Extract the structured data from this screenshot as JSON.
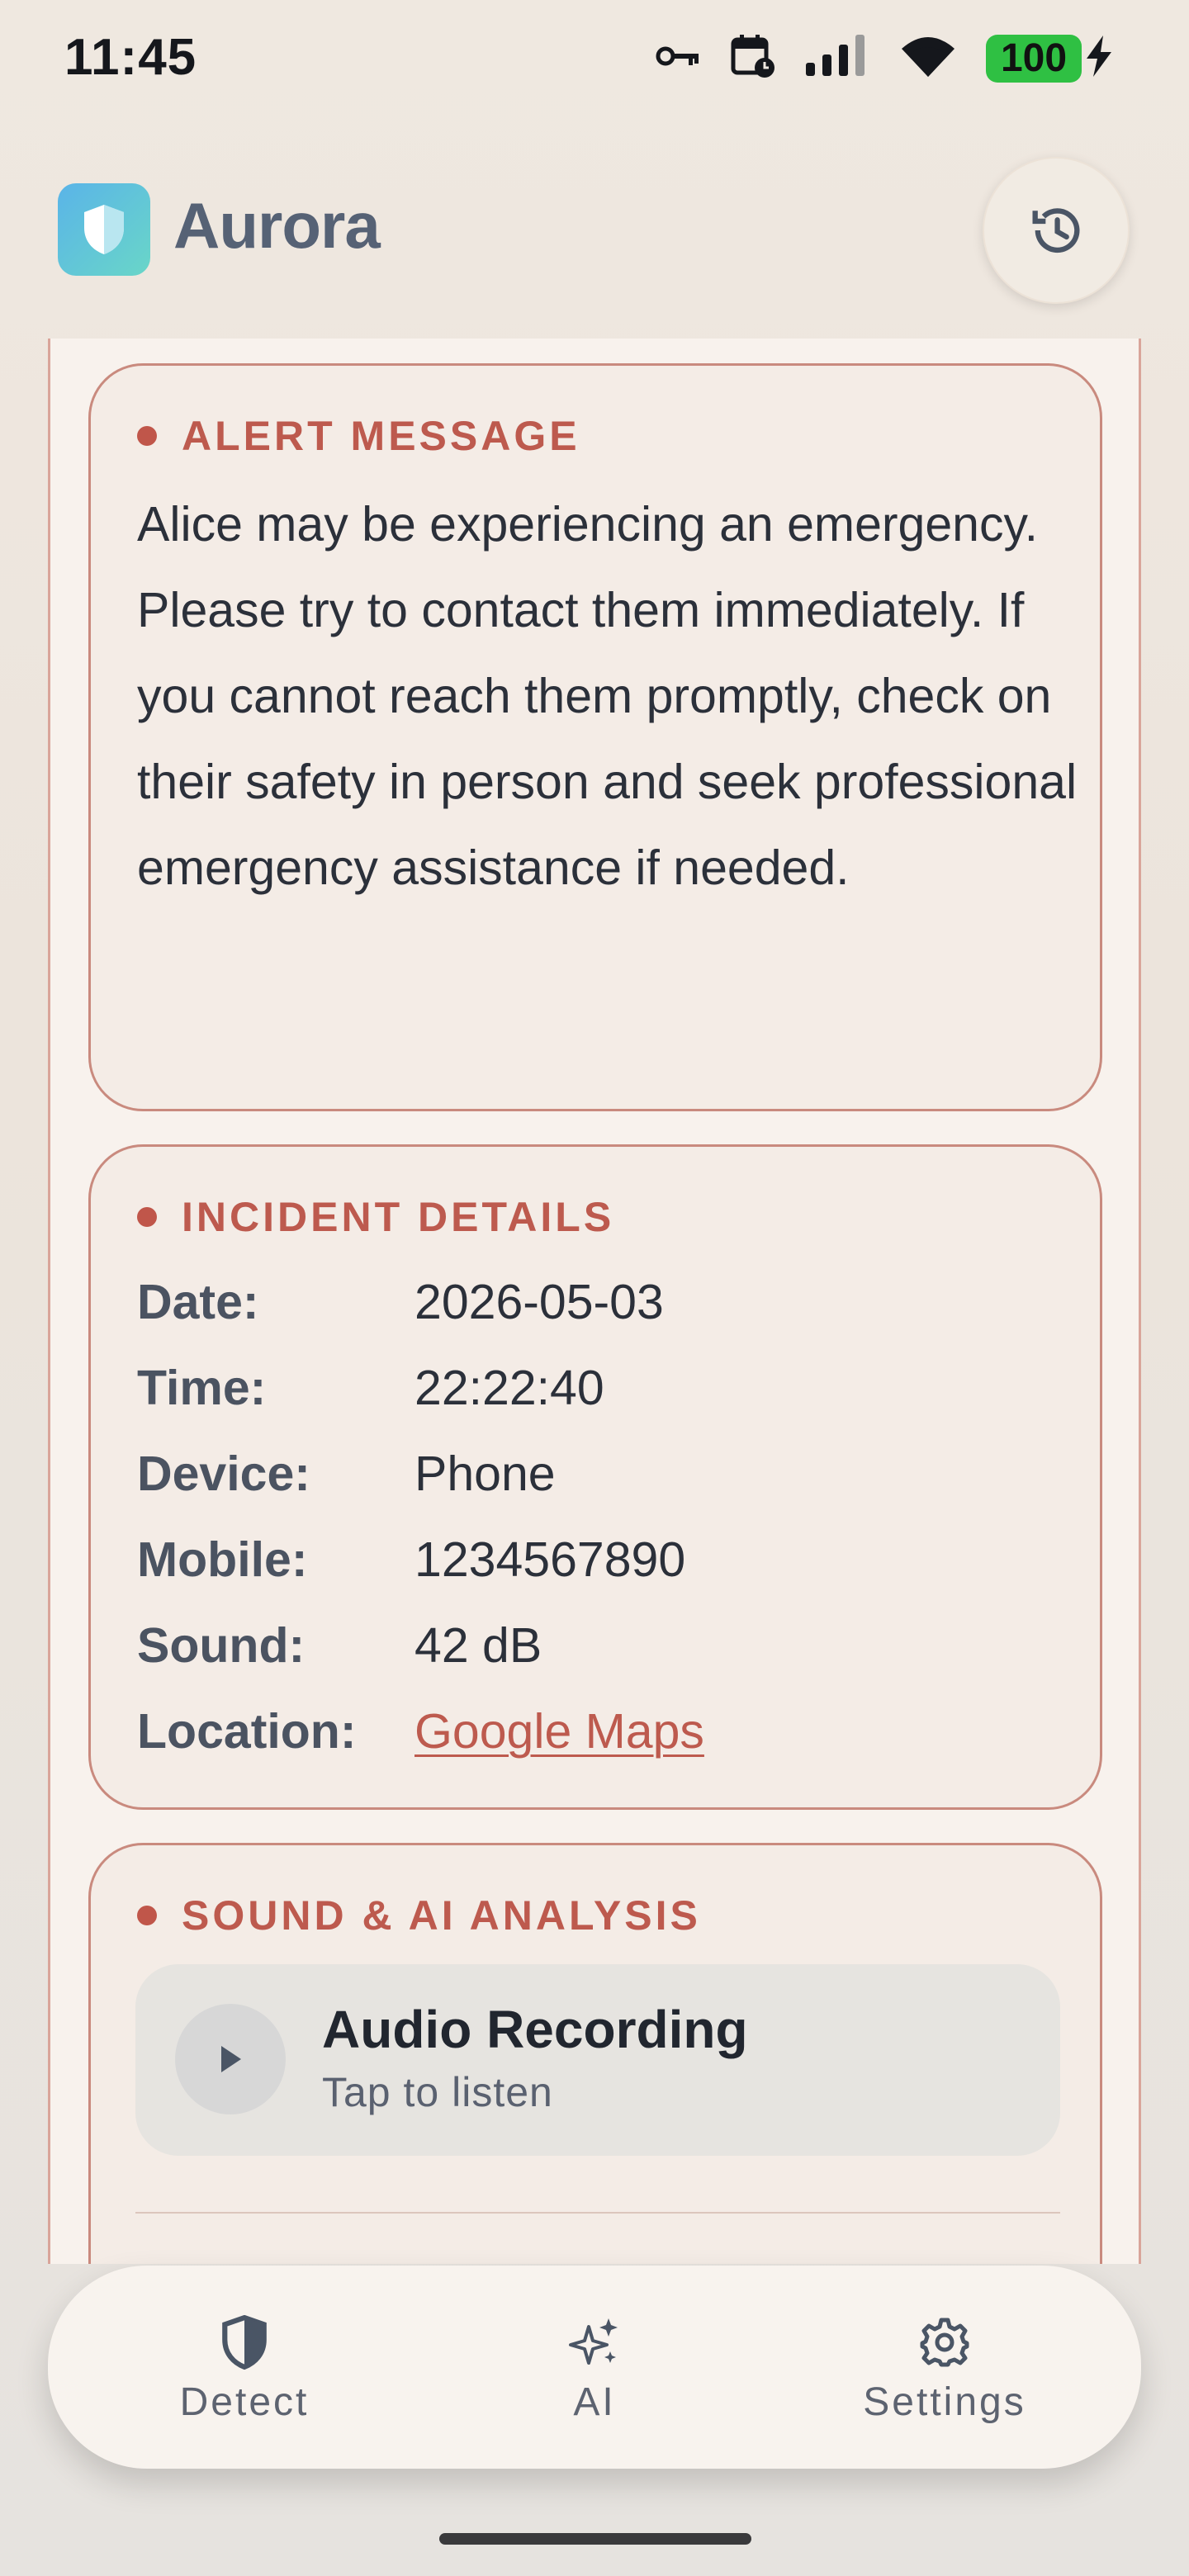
{
  "status_bar": {
    "time": "11:45",
    "battery": "100"
  },
  "header": {
    "app_name": "Aurora"
  },
  "alert_card": {
    "heading": "ALERT MESSAGE",
    "message": "Alice may be experiencing an emergency. Please try to contact them immediately. If you cannot reach them promptly, check on their safety in person and seek professional emergency assistance if needed."
  },
  "incident_card": {
    "heading": "INCIDENT DETAILS",
    "rows": [
      {
        "label": "Date:",
        "value": "2026-05-03"
      },
      {
        "label": "Time:",
        "value": "22:22:40"
      },
      {
        "label": "Device:",
        "value": "Phone"
      },
      {
        "label": "Mobile:",
        "value": "1234567890"
      },
      {
        "label": "Sound:",
        "value": "42 dB"
      },
      {
        "label": "Location:",
        "value": "Google Maps"
      }
    ]
  },
  "sound_card": {
    "heading": "SOUND & AI ANALYSIS",
    "audio_title": "Audio Recording",
    "audio_subtitle": "Tap to listen"
  },
  "bottom_nav": {
    "items": [
      {
        "label": "Detect",
        "icon": "shield-icon"
      },
      {
        "label": "AI",
        "icon": "sparkles-icon"
      },
      {
        "label": "Settings",
        "icon": "gear-icon"
      }
    ]
  },
  "colors": {
    "accent": "#bd5a4e",
    "card_border": "#c98a7e",
    "battery": "#2fc043",
    "logo_start": "#5ab4e8",
    "logo_end": "#69d6c8"
  }
}
